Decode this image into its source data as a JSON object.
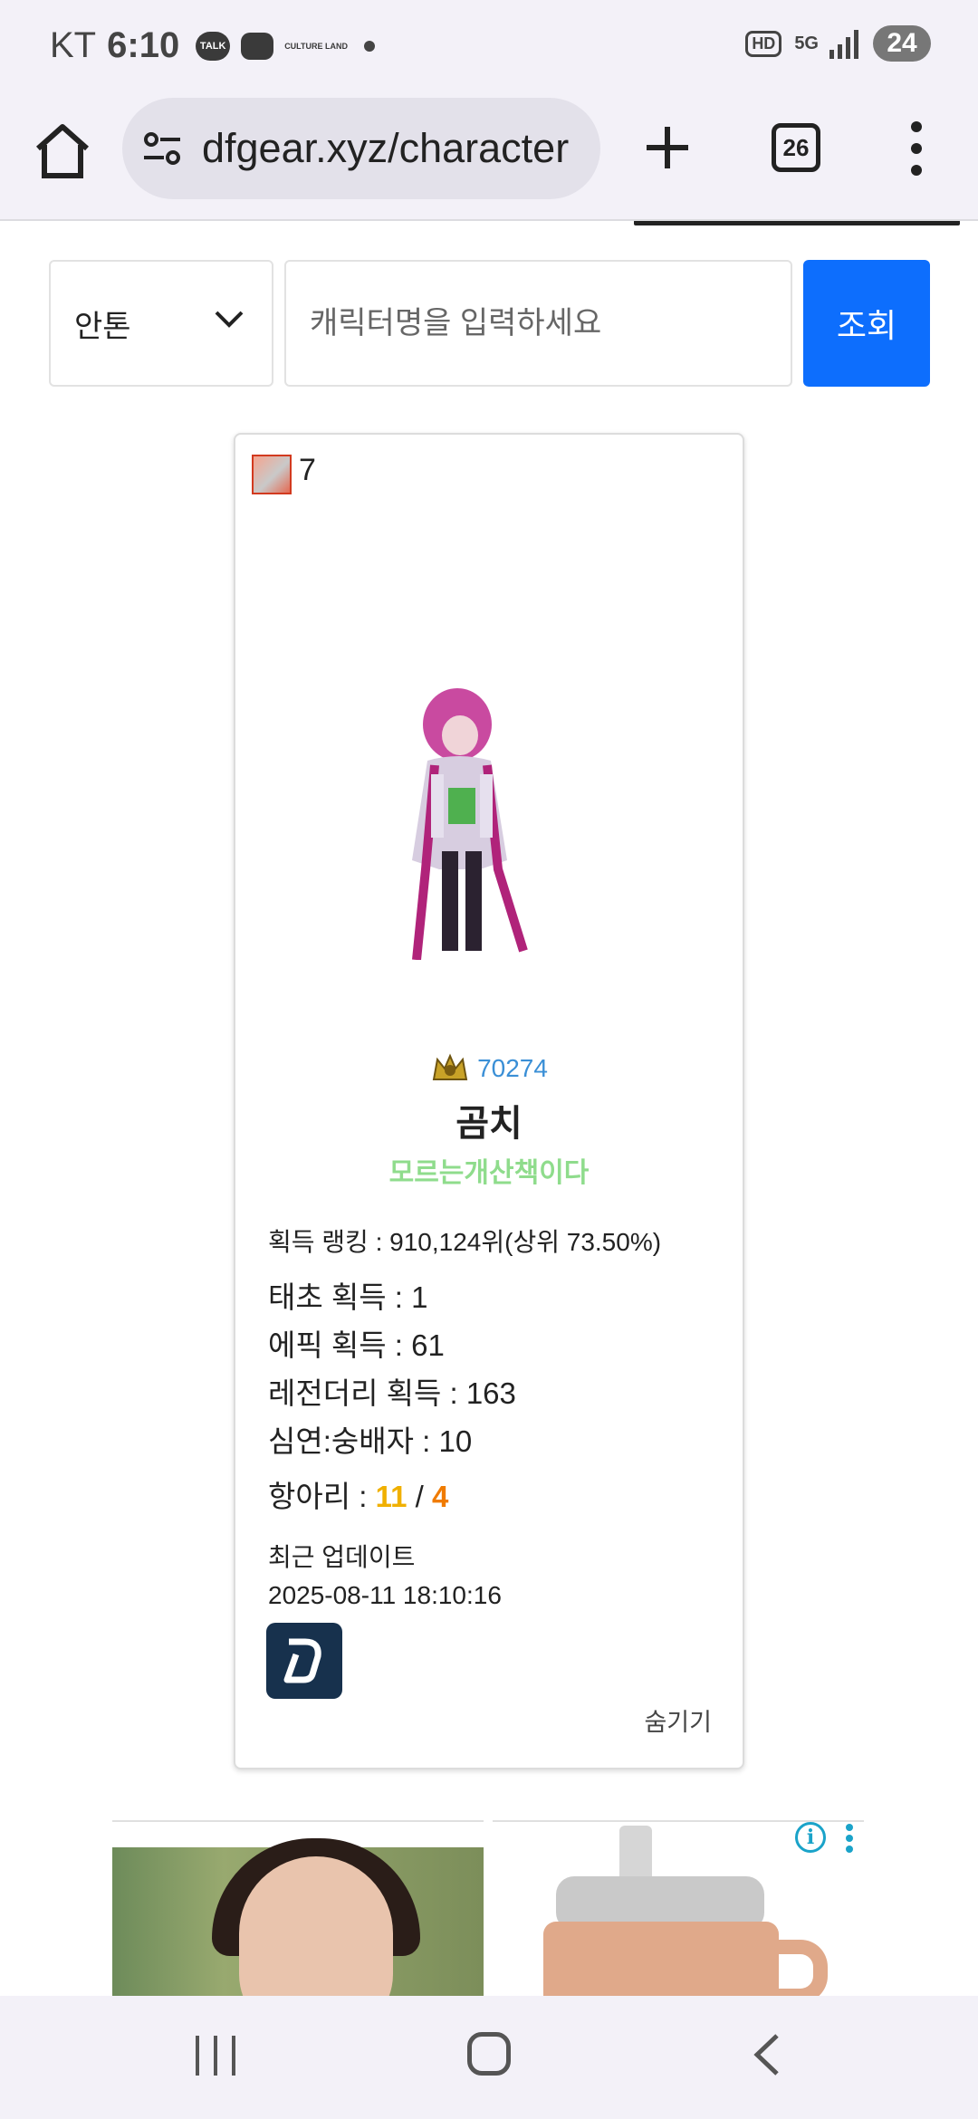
{
  "status_bar": {
    "carrier": "KT",
    "time": "6:10",
    "notif_talk": "TALK",
    "notif_culture": "CULTURE LAND",
    "hd": "HD",
    "network": "5G",
    "battery": "24"
  },
  "browser": {
    "url": "dfgear.xyz/character",
    "tab_count": "26"
  },
  "search": {
    "server": "안톤",
    "placeholder": "캐릭터명을 입력하세요",
    "button": "조회"
  },
  "character": {
    "adventure_level": "7",
    "fame": "70274",
    "name": "곰치",
    "guild": "모르는개산책이다",
    "rank_line": "획득 랭킹 : 910,124위(상위 73.50%)",
    "taecho": "태초 획득 : 1",
    "epic": "에픽 획득 : 61",
    "legendary": "레전더리 획득 : 163",
    "abyss": "심연:숭배자 : 10",
    "jar_label": "항아리 : ",
    "jar_a": "11",
    "jar_sep": " / ",
    "jar_b": "4",
    "update_label": "최근 업데이트",
    "update_time": "2025-08-11 18:10:16",
    "hide": "숨기기"
  },
  "colors": {
    "accent": "#0d6efd",
    "fame": "#3a8fd6",
    "guild": "#8fdc8c",
    "jar_a": "#f0b000",
    "jar_b": "#f07b00"
  }
}
